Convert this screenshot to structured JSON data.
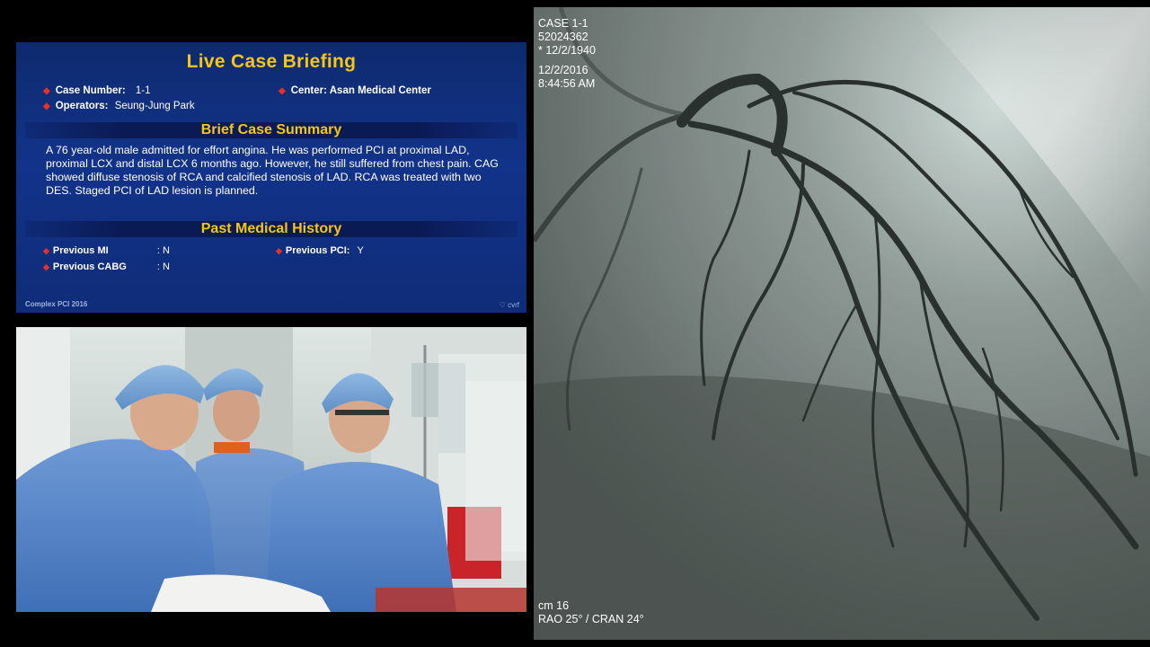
{
  "slide": {
    "title": "Live Case Briefing",
    "case_number_label": "Case Number:",
    "case_number_value": "1-1",
    "center_label": "Center:",
    "center_value": "Asan Medical Center",
    "operators_label": "Operators:",
    "operators_value": "Seung-Jung Park",
    "summary_heading": "Brief Case Summary",
    "summary_text": "A 76 year-old male admitted for effort angina. He was performed PCI at proximal LAD, proximal LCX and distal LCX 6 months ago. However, he still suffered from chest pain. CAG showed diffuse stenosis of RCA and calcified stenosis of LAD. RCA was treated with two DES. Staged PCI of LAD lesion is planned.",
    "history_heading": "Past Medical History",
    "history": [
      {
        "label": "Previous MI",
        "value": ": N"
      },
      {
        "label": "Previous PCI:",
        "value": "Y"
      },
      {
        "label": "Previous CABG",
        "value": ": N"
      }
    ],
    "footer_left": "Complex PCI 2016",
    "footer_right": "♡ cvrf"
  },
  "angio": {
    "case": "CASE 1-1",
    "patient_id": "52024362",
    "dob": "* 12/2/1940",
    "date": "12/2/2016",
    "time": "8:44:56 AM",
    "scale": "cm 16",
    "view": "RAO 25° / CRAN 24°"
  },
  "colors": {
    "slide_title": "#f5c518",
    "bullet": "#e4322b",
    "slide_bg": "#12338a"
  }
}
